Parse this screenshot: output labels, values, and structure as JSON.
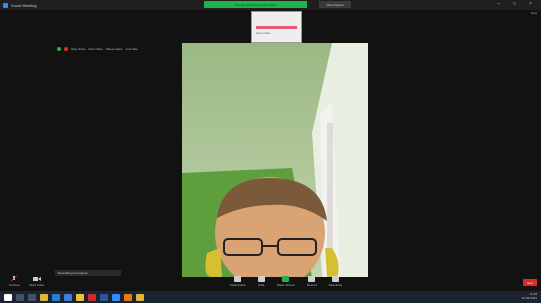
{
  "window": {
    "title": "Zoom Meeting"
  },
  "share_banner": {
    "text": "You are viewing a screen share",
    "secondary": "View Options"
  },
  "view_button": {
    "label": "View"
  },
  "share_toolbar": {
    "items": [
      "Stop share",
      "New share",
      "Pause share",
      "Annotate"
    ]
  },
  "thumbnail": {
    "text": "screen share"
  },
  "toast": {
    "text": "Recording in progress"
  },
  "bottom_left": {
    "items": [
      "Unmute",
      "Start Video"
    ]
  },
  "toolbar": {
    "items": [
      {
        "label": "Participants",
        "icon": "participants-icon"
      },
      {
        "label": "Chat",
        "icon": "chat-icon"
      },
      {
        "label": "Share Screen",
        "icon": "share-screen-icon"
      },
      {
        "label": "Record",
        "icon": "record-icon"
      },
      {
        "label": "Reactions",
        "icon": "reactions-icon"
      }
    ]
  },
  "end_button": {
    "label": "End"
  },
  "taskbar": {
    "apps": [
      "start",
      "search",
      "task-view",
      "explorer",
      "edge",
      "mail",
      "chrome",
      "acrobat",
      "word",
      "zoom",
      "vlc",
      "files"
    ],
    "time": "11:25",
    "date": "12-09-2021",
    "colors": {
      "start": "#ffffff",
      "edge": "#2a7bd6",
      "chrome": "#e8c33a",
      "acrobat": "#d22b2b",
      "zoom": "#2d8cff"
    }
  }
}
